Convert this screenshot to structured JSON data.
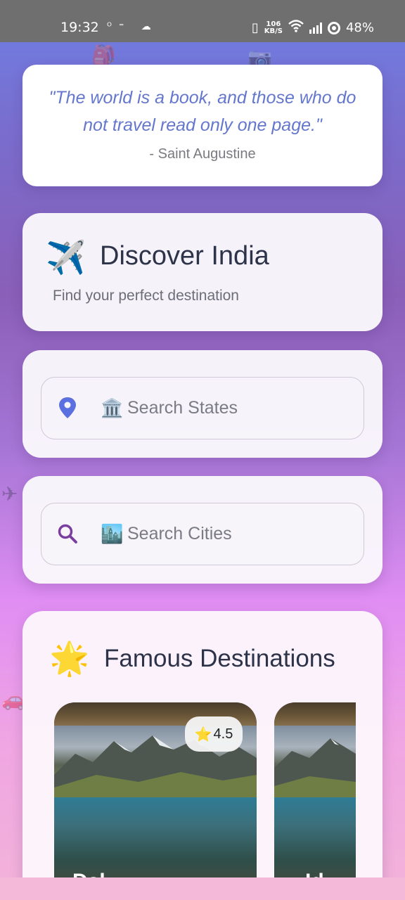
{
  "status_bar": {
    "time": "19:32",
    "left_icons": "ᴼ⁼ ☁",
    "speed_value": "106",
    "speed_unit": "KB/S",
    "battery": "48%"
  },
  "quote": {
    "text": "\"The world is a book, and those who do not travel read only one page.\"",
    "author": "- Saint Augustine"
  },
  "discover": {
    "icon": "✈️",
    "title": "Discover India",
    "subtitle": "Find your perfect destination"
  },
  "search_states": {
    "icon": "location-pin-icon",
    "emoji": "🏛️",
    "placeholder": "Search States"
  },
  "search_cities": {
    "icon": "search-icon",
    "emoji": "🏙️",
    "placeholder": "Search Cities"
  },
  "famous": {
    "icon": "🌟",
    "title": "Famous Destinations",
    "cards": [
      {
        "rating_icon": "⭐",
        "rating": "4.5",
        "name": "Dal"
      },
      {
        "name": "Id"
      }
    ]
  },
  "colors": {
    "accent_blue": "#6477cc",
    "pin_blue": "#5b6fe0",
    "search_purple": "#7a3f9e"
  }
}
